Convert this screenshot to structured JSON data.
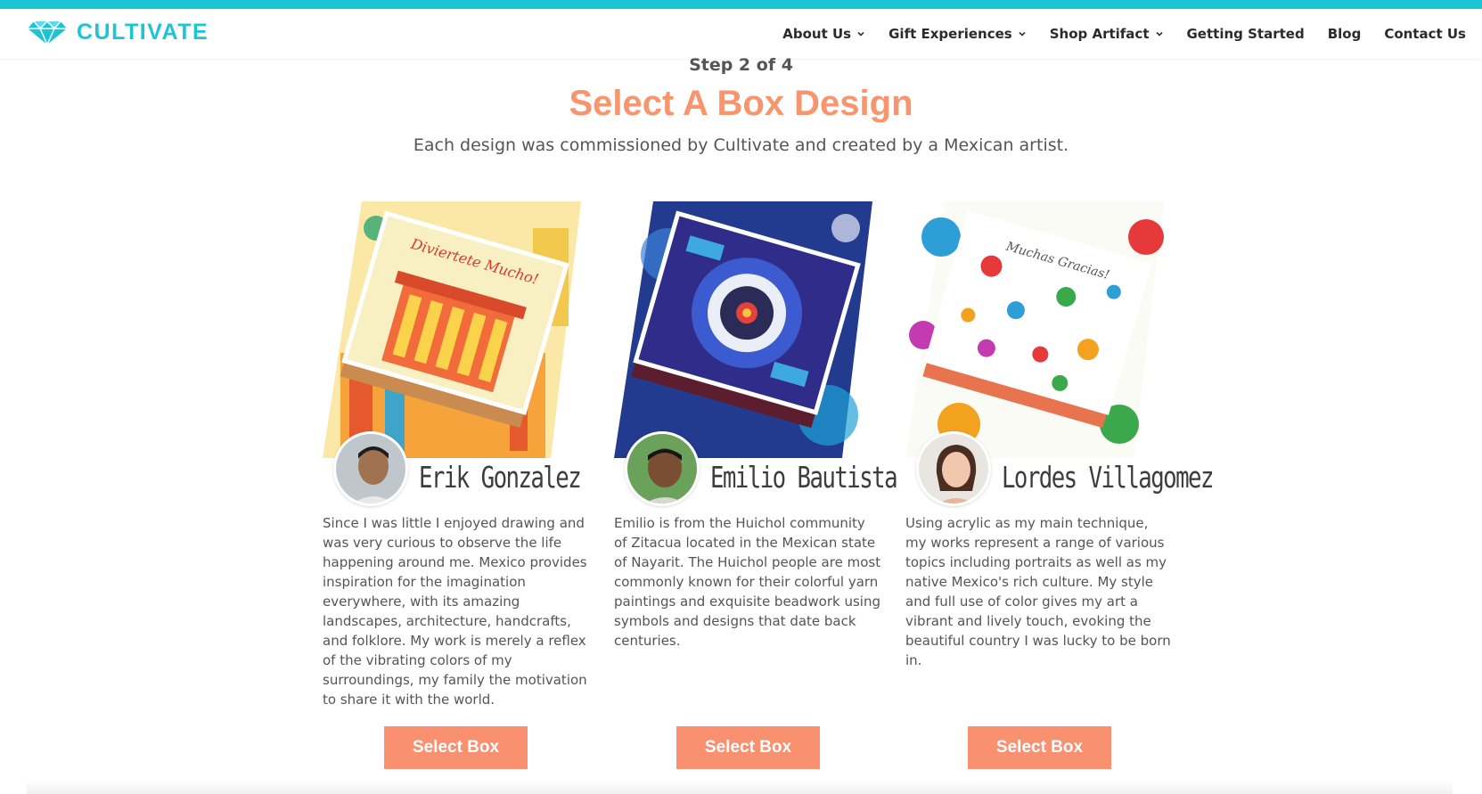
{
  "brand": {
    "name": "CULTIVATE",
    "color": "#1cc4d6"
  },
  "nav": {
    "items": [
      {
        "label": "About Us",
        "dropdown": true
      },
      {
        "label": "Gift Experiences",
        "dropdown": true
      },
      {
        "label": "Shop Artifact",
        "dropdown": true
      },
      {
        "label": "Getting Started",
        "dropdown": false
      },
      {
        "label": "Blog",
        "dropdown": false
      },
      {
        "label": "Contact Us",
        "dropdown": false
      }
    ]
  },
  "main": {
    "step": "Step 2 of 4",
    "title": "Select A Box Design",
    "subtitle": "Each design was commissioned by Cultivate and created by a Mexican artist.",
    "accent_color": "#f9906f",
    "cards": [
      {
        "artist": "Erik Gonzalez",
        "bio": "Since I was little I enjoyed drawing and was very curious to observe the life happening around me. Mexico provides inspiration for the imagination everywhere, with its amazing landscapes, architecture, handcrafts, and folklore. My work is merely a reflex of the vibrating colors of my surroundings, my family the motivation to share it with the world.",
        "button": "Select Box",
        "box_lettering": "Diviertete Mucho!"
      },
      {
        "artist": "Emilio Bautista",
        "bio": "Emilio is from the Huichol community of Zitacua located in the Mexican state of Nayarit. The Huichol people are most commonly known for their colorful yarn paintings and exquisite beadwork using symbols and designs that date back centuries.",
        "button": "Select Box"
      },
      {
        "artist": "Lordes Villagomez",
        "bio": "Using acrylic as my main technique, my works represent a range of various topics including portraits as well as my native Mexico's rich culture. My style and full use of color gives my art a vibrant and lively touch, evoking the beautiful country I was lucky to be born in.",
        "button": "Select Box",
        "box_lettering": "Muchas Gracias!"
      }
    ]
  }
}
